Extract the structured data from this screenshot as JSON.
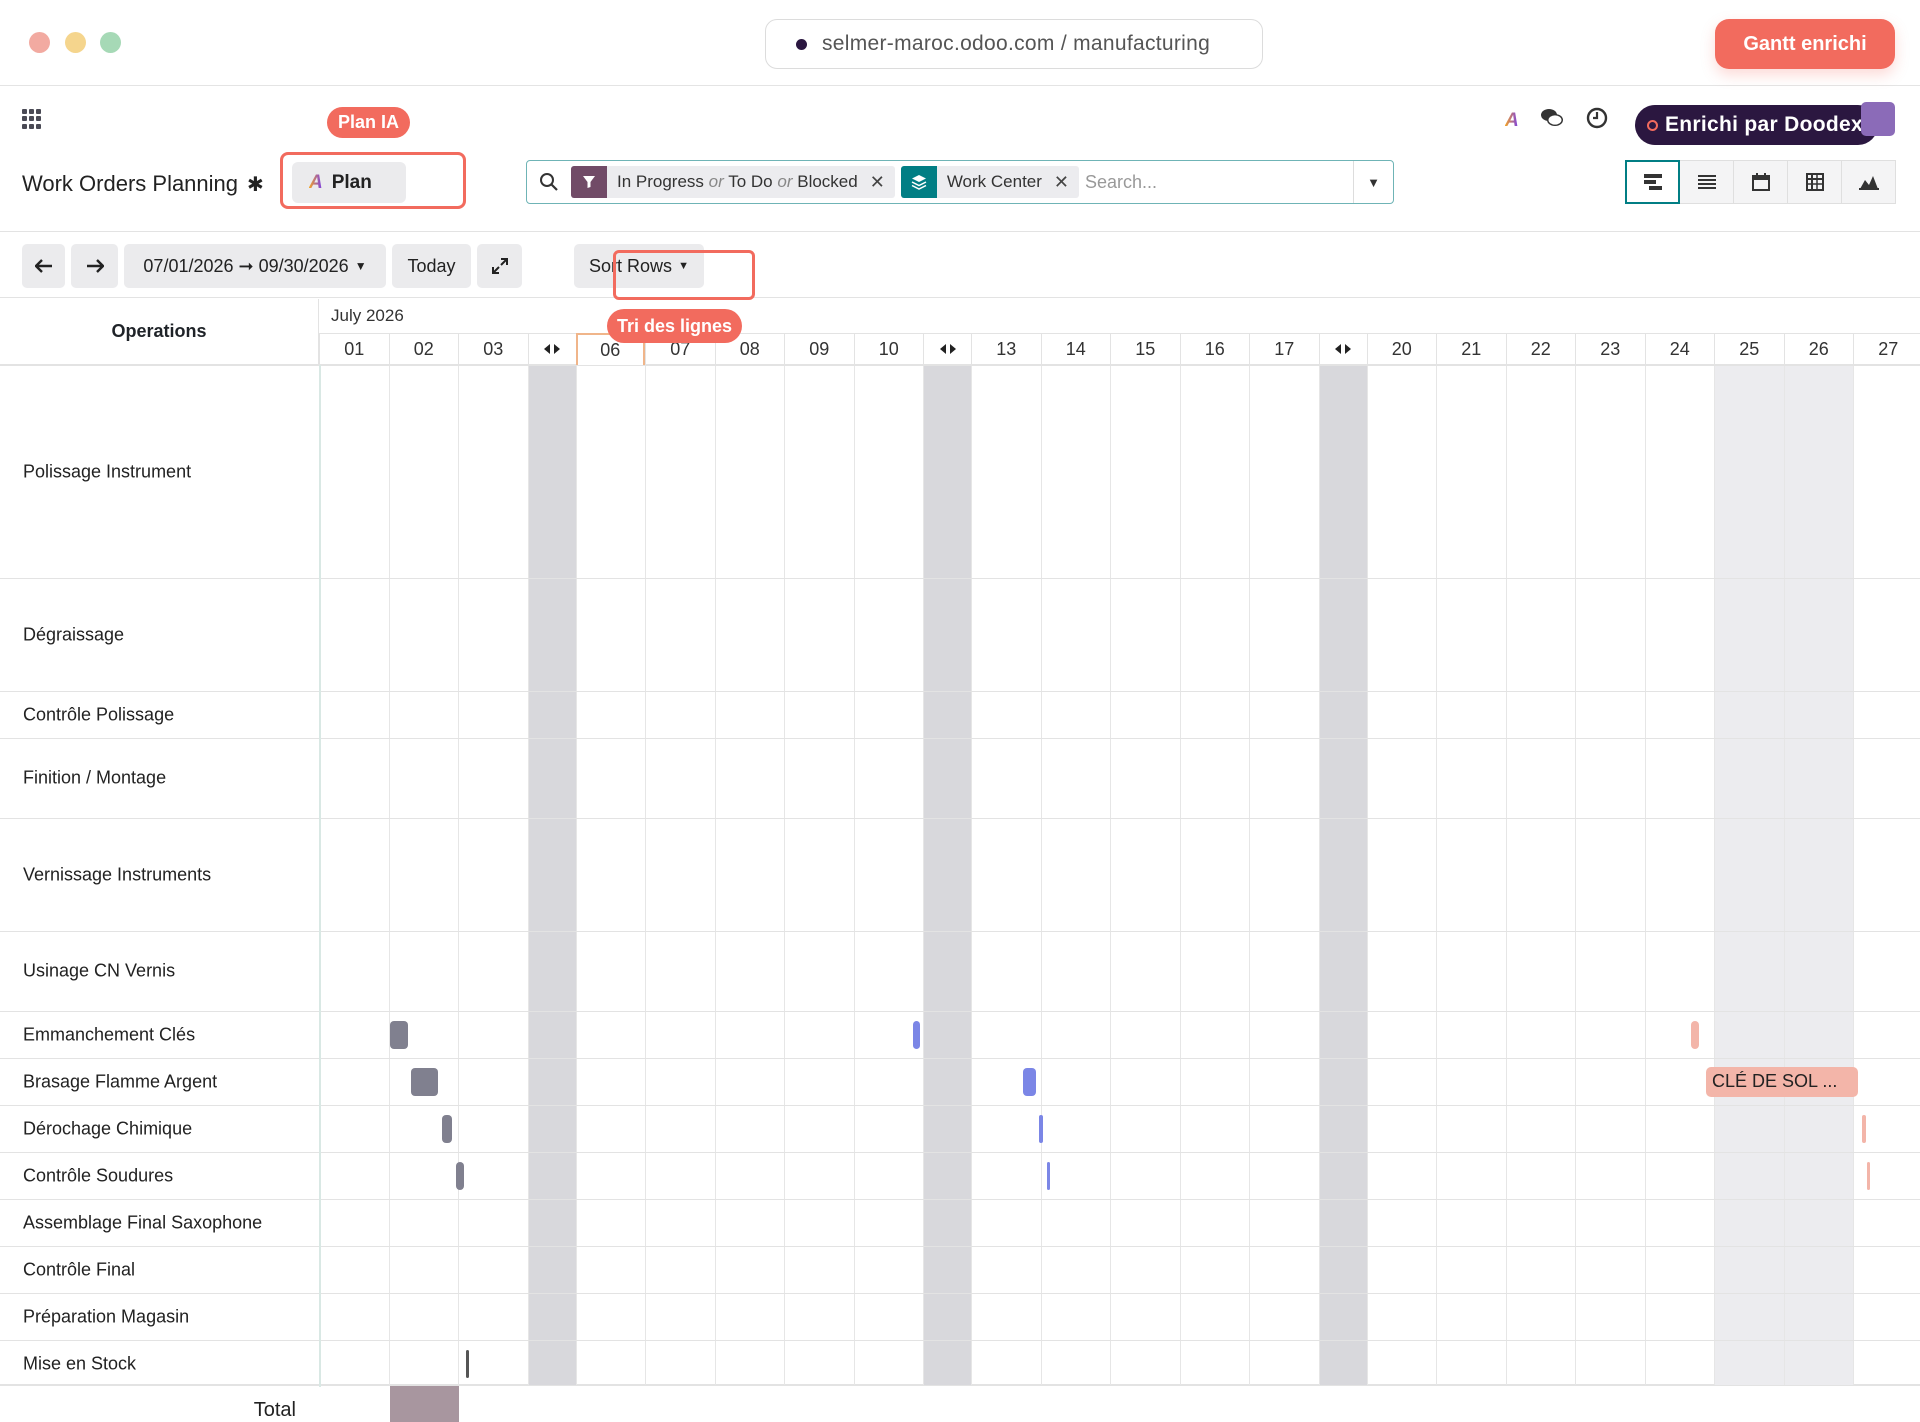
{
  "browser": {
    "url": "selmer-maroc.odoo.com / manufacturing",
    "badge": "Gantt enrichi"
  },
  "annotations": {
    "plan_ia": "Plan IA",
    "doodex": "Enrichi par Doodex",
    "tri": "Tri des lignes"
  },
  "header": {
    "title": "Work Orders Planning",
    "plan_label": "Plan",
    "ai_logo": "A"
  },
  "search": {
    "facet1": {
      "a": "In Progress",
      "or1": "or",
      "b": "To Do",
      "or2": "or",
      "c": "Blocked"
    },
    "facet2": "Work Center",
    "placeholder": "Search..."
  },
  "toolbar": {
    "date_range": "07/01/2026 ➞ 09/30/2026",
    "today": "Today",
    "sort": "Sort Rows"
  },
  "gantt": {
    "ops_header": "Operations",
    "month": "July 2026",
    "days": [
      "01",
      "02",
      "03",
      "",
      "06",
      "07",
      "08",
      "09",
      "10",
      "",
      "13",
      "14",
      "15",
      "16",
      "17",
      "",
      "20",
      "21",
      "22",
      "23",
      "24",
      "25",
      "26",
      "27"
    ],
    "rows": [
      "Polissage Instrument",
      "Dégraissage",
      "Contrôle Polissage",
      "Finition / Montage",
      "Vernissage Instruments",
      "Usinage CN Vernis",
      "Emmanchement Clés",
      "Brasage Flamme Argent",
      "Dérochage Chimique",
      "Contrôle Soudures",
      "Assemblage Final Saxophone",
      "Contrôle Final",
      "Préparation Magasin",
      "Mise en Stock"
    ],
    "pill_label": "CLÉ DE SOL ...",
    "total_label": "Total",
    "colors": {
      "grey_bar": "#80808f",
      "blue_bar": "#7b86e6",
      "salmon": "#f3b5a9"
    }
  }
}
